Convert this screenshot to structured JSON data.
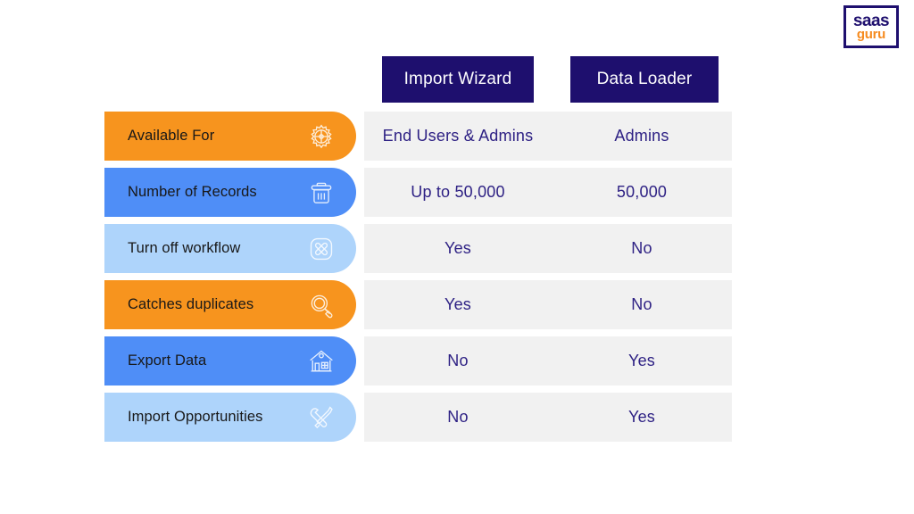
{
  "logo": {
    "line1": "saas",
    "line2": "guru",
    "border_color": "#1e0f6e",
    "line1_color": "#1e0f6e",
    "line2_color": "#f68b1f"
  },
  "colors": {
    "header_bg": "#1e0f6e",
    "header_text": "#ffffff",
    "orange": "#f7941e",
    "blue": "#4f8ef7",
    "light_blue": "#aed4fb",
    "cell_bg": "#f1f1f1",
    "cell_text": "#2e2184"
  },
  "table": {
    "columns": [
      {
        "label": "Import Wizard"
      },
      {
        "label": "Data Loader"
      }
    ],
    "rows": [
      {
        "label": "Available For",
        "icon": "gear-icon",
        "pill_color": "orange",
        "import_wizard": "End Users & Admins",
        "data_loader": "Admins"
      },
      {
        "label": "Number of Records",
        "icon": "trash-icon",
        "pill_color": "blue",
        "import_wizard": "Up to 50,000",
        "data_loader": "50,000"
      },
      {
        "label": "Turn off workflow",
        "icon": "cross-square-icon",
        "pill_color": "light",
        "import_wizard": "Yes",
        "data_loader": "No"
      },
      {
        "label": "Catches duplicates",
        "icon": "magnifier-icon",
        "pill_color": "orange",
        "import_wizard": "Yes",
        "data_loader": "No"
      },
      {
        "label": "Export Data",
        "icon": "bank-building-icon",
        "pill_color": "blue",
        "import_wizard": "No",
        "data_loader": "Yes"
      },
      {
        "label": "Import Opportunities",
        "icon": "tools-icon",
        "pill_color": "light",
        "import_wizard": "No",
        "data_loader": "Yes"
      }
    ]
  }
}
